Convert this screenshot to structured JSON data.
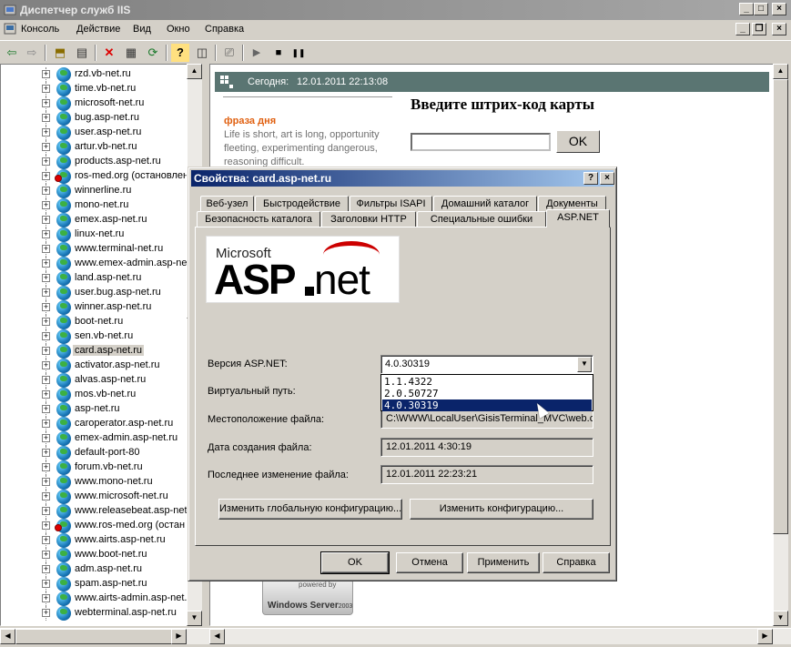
{
  "window": {
    "title": "Диспетчер служб IIS",
    "controls": {
      "minimize": "_",
      "maximize": "□",
      "close": "×"
    }
  },
  "menu": {
    "items": [
      "Консоль",
      "Действие",
      "Вид",
      "Окно",
      "Справка"
    ],
    "child_controls": {
      "minimize": "_",
      "restore": "❐",
      "close": "×"
    }
  },
  "toolbar": {
    "icons": [
      "back-arrow-icon",
      "forward-arrow-icon",
      "up-folder-icon",
      "show-tree-icon",
      "delete-icon",
      "properties-icon",
      "refresh-icon",
      "help-icon",
      "console-tree-icon",
      "computer-icon",
      "play-icon",
      "stop-icon",
      "pause-icon"
    ],
    "glyphs": {
      "back": "⇦",
      "forward": "⇨",
      "up": "⬒",
      "tree": "▤",
      "delete": "✕",
      "properties": "▦",
      "refresh": "⟳",
      "help": "?",
      "console": "◫",
      "computer": "⎚",
      "play": "▶",
      "stop": "■",
      "pause": "❚❚"
    }
  },
  "tree": {
    "items": [
      {
        "label": "rzd.vb-net.ru",
        "stopped": false
      },
      {
        "label": "time.vb-net.ru",
        "stopped": false
      },
      {
        "label": "microsoft-net.ru",
        "stopped": false
      },
      {
        "label": "bug.asp-net.ru",
        "stopped": false
      },
      {
        "label": "user.asp-net.ru",
        "stopped": false
      },
      {
        "label": "artur.vb-net.ru",
        "stopped": false
      },
      {
        "label": "products.asp-net.ru",
        "stopped": false
      },
      {
        "label": "ros-med.org (остановлен",
        "stopped": true
      },
      {
        "label": "winnerline.ru",
        "stopped": false
      },
      {
        "label": "mono-net.ru",
        "stopped": false
      },
      {
        "label": "emex.asp-net.ru",
        "stopped": false
      },
      {
        "label": "linux-net.ru",
        "stopped": false
      },
      {
        "label": "www.terminal-net.ru",
        "stopped": false
      },
      {
        "label": "www.emex-admin.asp-ne",
        "stopped": false
      },
      {
        "label": "land.asp-net.ru",
        "stopped": false
      },
      {
        "label": "user.bug.asp-net.ru",
        "stopped": false
      },
      {
        "label": "winner.asp-net.ru",
        "stopped": false
      },
      {
        "label": "boot-net.ru",
        "stopped": false
      },
      {
        "label": "sen.vb-net.ru",
        "stopped": false
      },
      {
        "label": "card.asp-net.ru",
        "stopped": false,
        "selected": true
      },
      {
        "label": "activator.asp-net.ru",
        "stopped": false
      },
      {
        "label": "alvas.asp-net.ru",
        "stopped": false
      },
      {
        "label": "mos.vb-net.ru",
        "stopped": false
      },
      {
        "label": "asp-net.ru",
        "stopped": false
      },
      {
        "label": "caroperator.asp-net.ru",
        "stopped": false
      },
      {
        "label": "emex-admin.asp-net.ru",
        "stopped": false
      },
      {
        "label": "default-port-80",
        "stopped": false
      },
      {
        "label": "forum.vb-net.ru",
        "stopped": false
      },
      {
        "label": "www.mono-net.ru",
        "stopped": false
      },
      {
        "label": "www.microsoft-net.ru",
        "stopped": false
      },
      {
        "label": "www.releasebeat.asp-net",
        "stopped": false
      },
      {
        "label": "www.ros-med.org (остан",
        "stopped": true
      },
      {
        "label": "www.airts.asp-net.ru",
        "stopped": false
      },
      {
        "label": "www.boot-net.ru",
        "stopped": false
      },
      {
        "label": "adm.asp-net.ru",
        "stopped": false
      },
      {
        "label": "spam.asp-net.ru",
        "stopped": false
      },
      {
        "label": "www.airts-admin.asp-net.",
        "stopped": false
      },
      {
        "label": "webterminal.asp-net.ru",
        "stopped": false
      }
    ]
  },
  "web": {
    "today_label": "Сегодня:",
    "today_value": "12.01.2011 22:13:08",
    "phrase_title": "фраза дня",
    "phrase_text": "Life is short, art is long, opportunity fleeting, experimenting dangerous, reasoning difficult.",
    "barcode_heading": "Введите штрих-код карты",
    "barcode_value": "",
    "ok_label": "OK",
    "windows_logo": "Windows Server",
    "windows_logo_year": "2003",
    "windows_logo_top": "powered by"
  },
  "dialog": {
    "title": "Свойства: card.asp-net.ru",
    "help_glyph": "?",
    "close_glyph": "×",
    "tabs_row1": [
      "Веб-узел",
      "Быстродействие",
      "Фильтры ISAPI",
      "Домашний каталог",
      "Документы"
    ],
    "tabs_row2": [
      "Безопасность каталога",
      "Заголовки HTTP",
      "Специальные ошибки",
      "ASP.NET"
    ],
    "logo": {
      "microsoft": "Microsoft",
      "asp": "ASP",
      "net": "net"
    },
    "version_label": "Версия ASP.NET:",
    "version_value": "4.0.30319",
    "version_options": [
      "1.1.4322",
      "2.0.50727",
      "4.0.30319"
    ],
    "virtual_path_label": "Виртуальный путь:",
    "file_location_label": "Местоположение файла:",
    "file_location_value": "C:\\WWW\\LocalUser\\GisisTerminal_MVC\\web.co",
    "created_label": "Дата создания файла:",
    "created_value": "12.01.2011 4:30:19",
    "modified_label": "Последнее изменение файла:",
    "modified_value": "12.01.2011 22:23:21",
    "edit_global_button": "Изменить глобальную конфигурацию...",
    "edit_config_button": "Изменить конфигурацию...",
    "ok_button": "OK",
    "cancel_button": "Отмена",
    "apply_button": "Применить",
    "help_button": "Справка"
  }
}
